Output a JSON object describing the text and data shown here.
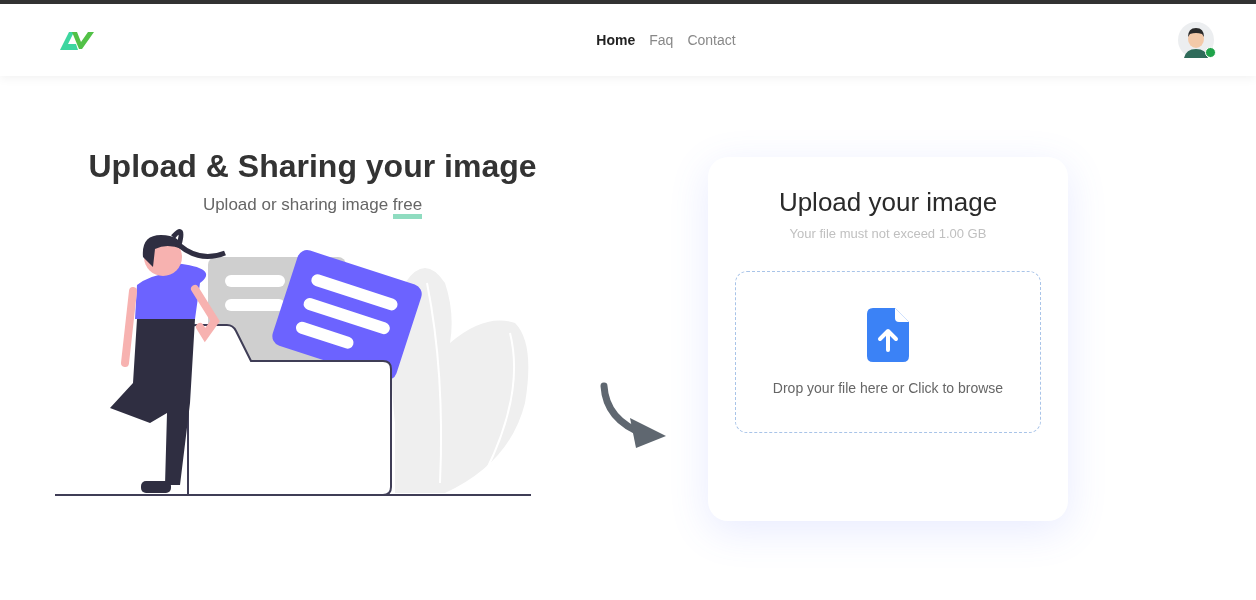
{
  "nav": [
    {
      "label": "Home",
      "selected": true
    },
    {
      "label": "Faq",
      "selected": false
    },
    {
      "label": "Contact",
      "selected": false
    }
  ],
  "user": {
    "online": true
  },
  "hero": {
    "title": "Upload & Sharing your image",
    "subtitle": "Upload or sharing image",
    "subtitle_highlight": "free"
  },
  "upload_card": {
    "title": "Upload your image",
    "note": "Your file must not exceed 1.00 GB",
    "drop_text": "Drop your file here or Click to browse"
  }
}
